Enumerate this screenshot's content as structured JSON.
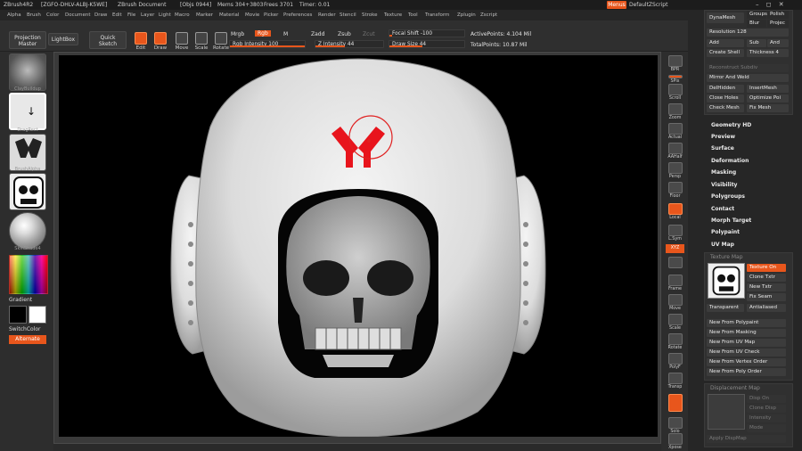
{
  "titlebar": {
    "app": "ZBrush4R2",
    "id": "[ZGFO-DHLV-ALBJ-K5WE]",
    "doc": "ZBrush Document",
    "objs": "[Objs 0944]",
    "mems": "Mems 304+3803",
    "frees": "Frees 3701",
    "timer": "Timer: 0.01",
    "menus": "Menus",
    "script": "DefaultZScript",
    "icons": "– ◻ ✕"
  },
  "menubar": [
    "Alpha",
    "Brush",
    "Color",
    "Document",
    "Draw",
    "Edit",
    "File",
    "Layer",
    "Light",
    "Macro",
    "Marker",
    "Material",
    "Movie",
    "Picker",
    "Preferences",
    "Render",
    "Stencil",
    "Stroke",
    "Texture",
    "Tool",
    "Transform",
    "Zplugin",
    "Zscript"
  ],
  "toolbar": {
    "projection_master": "Projection\nMaster",
    "lightbox": "LightBox",
    "quick_sketch": "Quick\nSketch",
    "edit": "Edit",
    "draw": "Draw",
    "move": "Move",
    "scale": "Scale",
    "rotate": "Rotate",
    "mrgb": "Mrgb",
    "rgb": "Rgb",
    "m": "M",
    "rgb_intensity": "Rgb Intensity 100",
    "zadd": "Zadd",
    "zsub": "Zsub",
    "zcut": "Zcut",
    "z_intensity": "Z Intensity 44",
    "focal_shift": "Focal Shift -100",
    "draw_size": "Draw Size 44",
    "active_points": "ActivePoints: 4.104 Mil",
    "total_points": "TotalPoints: 10.87 Mil"
  },
  "left_shelf": {
    "brush": "ClayBuildup",
    "stroke": "DragRect",
    "alpha": "BrushAlpha",
    "texture": "Texture",
    "material": "SkinShade4",
    "gradient": "Gradient",
    "switch_color": "SwitchColor",
    "alternate": "Alternate"
  },
  "right_shelf": [
    "BPR",
    "SPix",
    "Scroll",
    "Zoom",
    "Actual",
    "AAHalf",
    "Persp",
    "Floor",
    "Local",
    "L.Sym",
    "XYZ",
    "",
    "Frame",
    "Move",
    "Scale",
    "Rotate",
    "PolyF",
    "Transp",
    "",
    "Solo",
    "Xpose"
  ],
  "panel": {
    "dynamesh": "DynaMesh",
    "groups": "Groups",
    "polish": "Polish",
    "blur": "Blur",
    "project": "Projec",
    "resolution": "Resolution 128",
    "add": "Add",
    "sub": "Sub",
    "and": "And",
    "create_shell": "Create Shell",
    "thickness": "Thickness 4",
    "reconstruct_subdiv": "Reconstruct Subdiv",
    "mirror_and_weld": "Mirror And Weld",
    "delhidden": "DelHidden",
    "insertmesh": "InsertMesh",
    "close_holes": "Close Holes",
    "optimize": "Optimize Poi",
    "check_mesh": "Check Mesh",
    "fix_mesh": "Fix Mesh",
    "sections": [
      "Geometry HD",
      "Preview",
      "Surface",
      "Deformation",
      "Masking",
      "Visibility",
      "Polygroups",
      "Contact",
      "Morph Target",
      "Polypaint",
      "UV Map"
    ],
    "texture_map": "Texture Map",
    "texture_on": "Texture On",
    "clone_txtr": "Clone Txtr",
    "new_txtr": "New Txtr",
    "fix_seam": "Fix Seam",
    "transparent": "Transparent",
    "antialiased": "Antialiased",
    "new_from": [
      "New From Polypaint",
      "New From Masking",
      "New From UV Map",
      "New From UV Check",
      "New From Vertex Order",
      "New From Poly Order"
    ],
    "displacement_map": "Displacement Map",
    "disp_on": "Disp On",
    "clone_disp": "Clone Disp",
    "intensity": "Intensity",
    "mode": "Mode",
    "apply_dispmap": "Apply DispMap"
  },
  "colors": {
    "accent": "#e8561c",
    "canvas": "#000000",
    "panel": "#262626"
  }
}
